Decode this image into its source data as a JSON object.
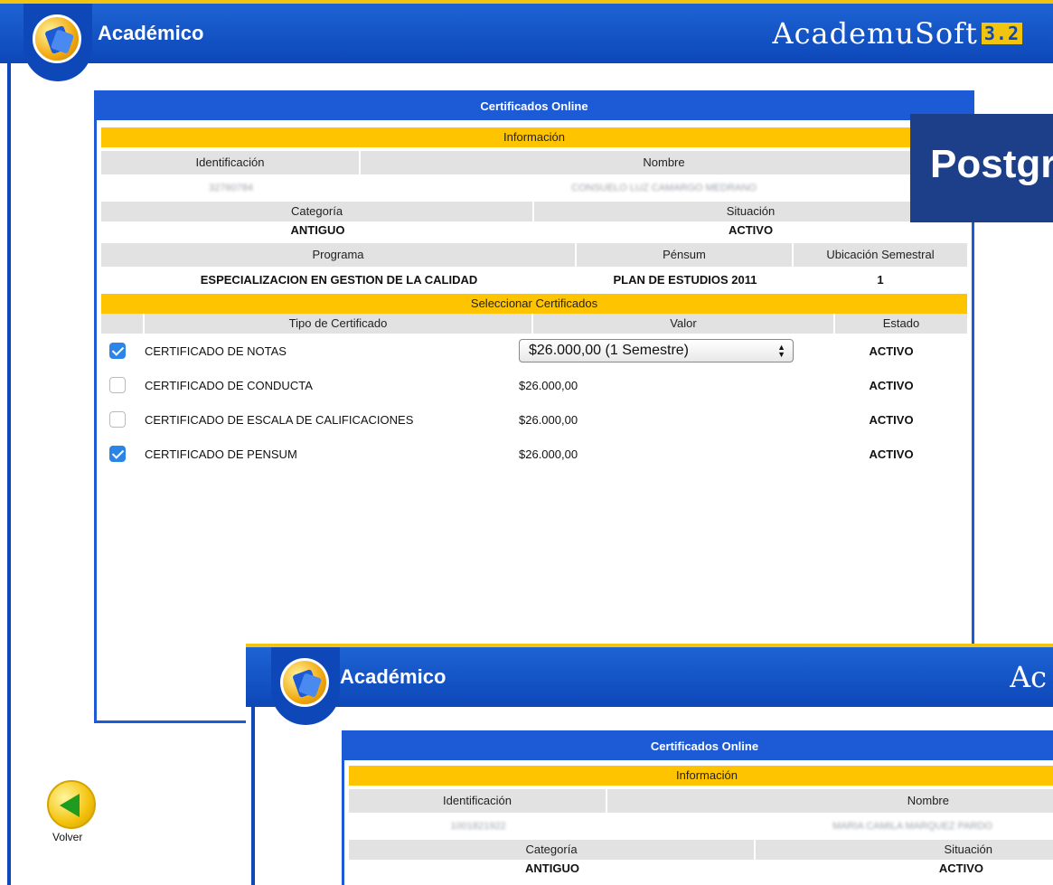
{
  "header": {
    "title": "Académico",
    "brand": "AcademuSoft",
    "brand_version": "3.2"
  },
  "panel": {
    "title": "Certificados Online",
    "info_bar": "Información",
    "headers_row1": [
      "Identificación",
      "Nombre"
    ],
    "values_row1": [
      "32760784",
      "CONSUELO LUZ CAMARGO MEDRANO"
    ],
    "headers_row2": [
      "Categoría",
      "Situación"
    ],
    "values_row2": [
      "ANTIGUO",
      "ACTIVO"
    ],
    "headers_row3": [
      "Programa",
      "Pénsum",
      "Ubicación Semestral"
    ],
    "values_row3": [
      "ESPECIALIZACION EN GESTION DE LA CALIDAD",
      "PLAN DE ESTUDIOS 2011",
      "1"
    ],
    "select_bar": "Seleccionar Certificados",
    "cert_headers": [
      "Tipo de Certificado",
      "Valor",
      "Estado"
    ],
    "certificates": [
      {
        "checked": true,
        "type": "CERTIFICADO DE NOTAS",
        "value": "$26.000,00 (1 Semestre)",
        "state": "ACTIVO"
      },
      {
        "checked": false,
        "type": "CERTIFICADO DE CONDUCTA",
        "value": "$26.000,00",
        "state": "ACTIVO"
      },
      {
        "checked": false,
        "type": "CERTIFICADO DE ESCALA DE CALIFICACIONES",
        "value": "$26.000,00",
        "state": "ACTIVO"
      },
      {
        "checked": true,
        "type": "CERTIFICADO DE PENSUM",
        "value": "$26.000,00",
        "state": "ACTIVO"
      }
    ]
  },
  "volver_label": "Volver",
  "banner_text": "Postgrado",
  "second": {
    "title": "Académico",
    "brand": "Ac",
    "panel_title": "Certificados Online",
    "info_bar": "Información",
    "headers_row1": [
      "Identificación",
      "Nombre"
    ],
    "values_row1": [
      "1001821922",
      "MARIA CAMILA MARQUEZ PARDO"
    ],
    "headers_row2": [
      "Categoría",
      "Situación"
    ],
    "values_row2": [
      "ANTIGUO",
      "ACTIVO"
    ]
  },
  "colors": {
    "header_blue": "#1d5ad6",
    "accent_yellow": "#ffc400",
    "banner_navy": "#1d3f8a",
    "checkbox_blue": "#2b84e6"
  }
}
